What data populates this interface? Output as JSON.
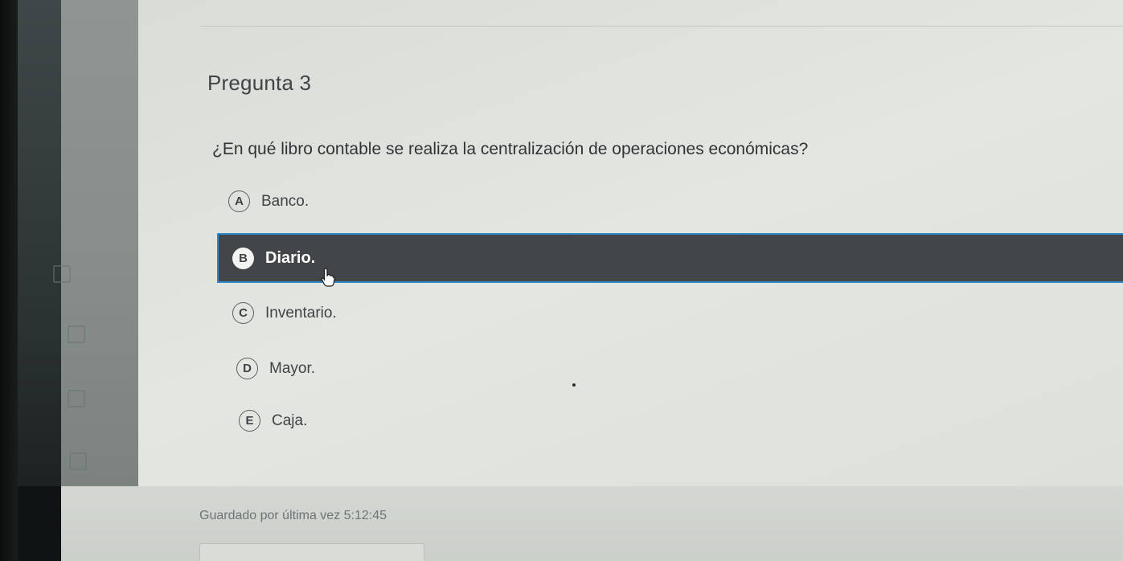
{
  "question": {
    "title": "Pregunta 3",
    "text": "¿En qué libro contable se realiza la centralización de operaciones económicas?"
  },
  "options": [
    {
      "letter": "A",
      "label": "Banco.",
      "selected": false
    },
    {
      "letter": "B",
      "label": "Diario.",
      "selected": true
    },
    {
      "letter": "C",
      "label": "Inventario.",
      "selected": false
    },
    {
      "letter": "D",
      "label": "Mayor.",
      "selected": false
    },
    {
      "letter": "E",
      "label": "Caja.",
      "selected": false
    }
  ],
  "footer": {
    "saved_text": "Guardado por última vez 5:12:45"
  },
  "colors": {
    "selected_background": "#434648",
    "selected_border": "#2f8bc8",
    "page_background": "#dfe1dc"
  },
  "icons": {
    "cursor": "hand-pointer-icon"
  }
}
